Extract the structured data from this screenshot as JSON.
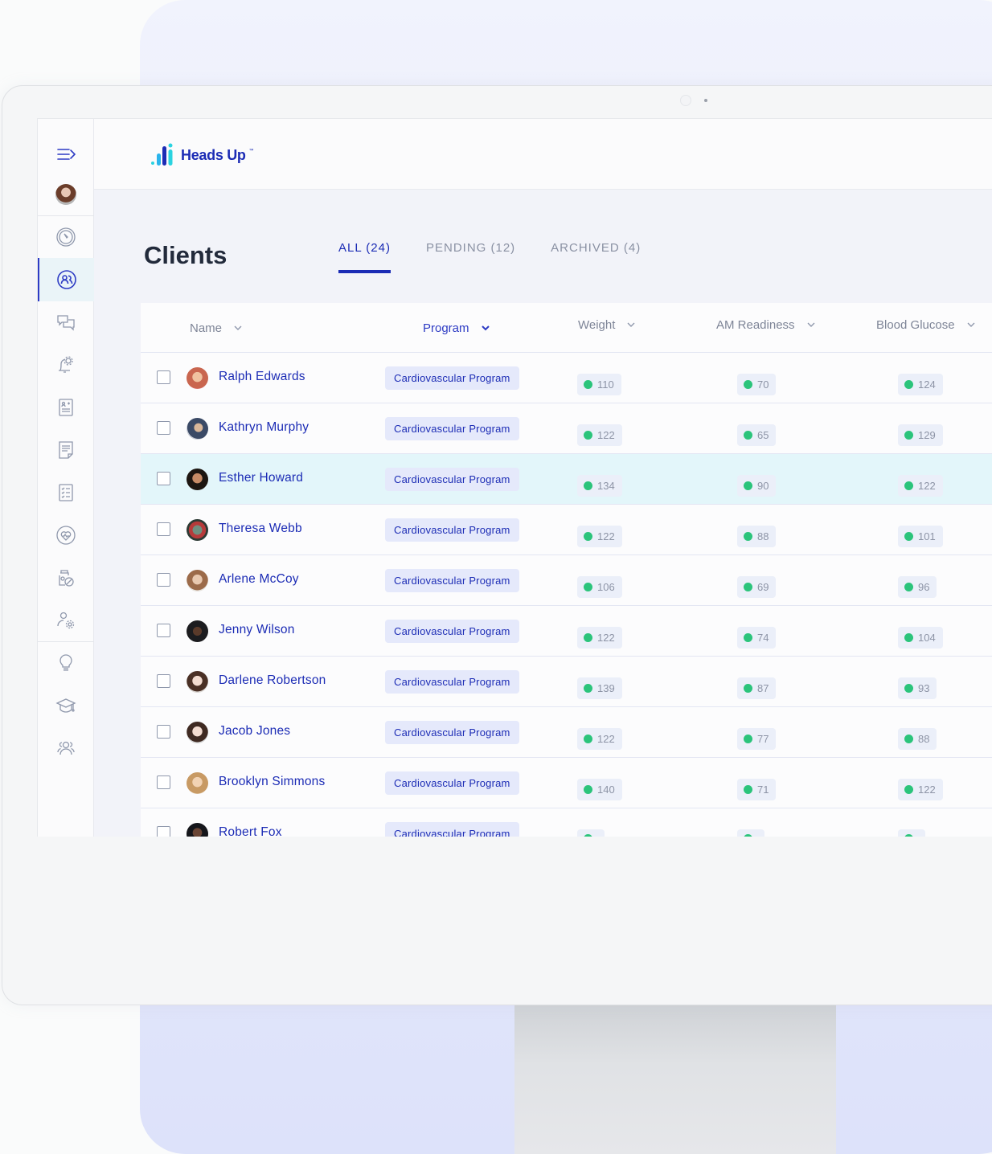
{
  "app": {
    "logo_text": "Heads Up",
    "logo_trademark": "™"
  },
  "colors": {
    "brand": "#1c2cb5",
    "status_good": "#2bc47b",
    "highlight_row": "#e3f6fa",
    "badge_bg": "#e5e9fb"
  },
  "sidebar": {
    "items": [
      {
        "icon": "menu-expand-icon",
        "label": "Menu"
      },
      {
        "icon": "avatar",
        "label": "Profile"
      },
      {
        "icon": "dashboard-gauge-icon",
        "label": "Dashboard"
      },
      {
        "icon": "clients-icon",
        "label": "Clients",
        "active": true
      },
      {
        "icon": "messages-icon",
        "label": "Messages"
      },
      {
        "icon": "notification-settings-icon",
        "label": "Notification settings"
      },
      {
        "icon": "client-report-icon",
        "label": "Reports"
      },
      {
        "icon": "document-icon",
        "label": "Documents"
      },
      {
        "icon": "checklist-icon",
        "label": "Checklists"
      },
      {
        "icon": "heart-health-icon",
        "label": "Health"
      },
      {
        "icon": "supplements-icon",
        "label": "Supplements"
      },
      {
        "icon": "user-settings-icon",
        "label": "User settings"
      },
      {
        "icon": "lightbulb-icon",
        "label": "Insights"
      },
      {
        "icon": "education-icon",
        "label": "Education"
      },
      {
        "icon": "team-icon",
        "label": "Team"
      }
    ]
  },
  "main": {
    "title": "Clients",
    "tabs": [
      {
        "label": "ALL (24)",
        "active": true
      },
      {
        "label": "PENDING (12)",
        "active": false
      },
      {
        "label": "ARCHIVED (4)",
        "active": false
      }
    ],
    "table": {
      "columns": [
        "Name",
        "Program",
        "Weight",
        "AM Readiness",
        "Blood Glucose"
      ],
      "rows": [
        {
          "name": "Ralph Edwards",
          "program": "Cardiovascular Program",
          "weight": "110",
          "am_readiness": "70",
          "blood_glucose": "124"
        },
        {
          "name": "Kathryn Murphy",
          "program": "Cardiovascular Program",
          "weight": "122",
          "am_readiness": "65",
          "blood_glucose": "129"
        },
        {
          "name": "Esther Howard",
          "program": "Cardiovascular Program",
          "weight": "134",
          "am_readiness": "90",
          "blood_glucose": "122",
          "highlighted": true
        },
        {
          "name": "Theresa Webb",
          "program": "Cardiovascular Program",
          "weight": "122",
          "am_readiness": "88",
          "blood_glucose": "101"
        },
        {
          "name": "Arlene McCoy",
          "program": "Cardiovascular Program",
          "weight": "106",
          "am_readiness": "69",
          "blood_glucose": "96"
        },
        {
          "name": "Jenny Wilson",
          "program": "Cardiovascular Program",
          "weight": "122",
          "am_readiness": "74",
          "blood_glucose": "104"
        },
        {
          "name": "Darlene Robertson",
          "program": "Cardiovascular Program",
          "weight": "139",
          "am_readiness": "87",
          "blood_glucose": "93"
        },
        {
          "name": "Jacob Jones",
          "program": "Cardiovascular Program",
          "weight": "122",
          "am_readiness": "77",
          "blood_glucose": "88"
        },
        {
          "name": "Brooklyn Simmons",
          "program": "Cardiovascular Program",
          "weight": "140",
          "am_readiness": "71",
          "blood_glucose": "122"
        },
        {
          "name": "Robert Fox",
          "program": "Cardiovascular Program",
          "weight": "",
          "am_readiness": "",
          "blood_glucose": ""
        }
      ]
    }
  }
}
